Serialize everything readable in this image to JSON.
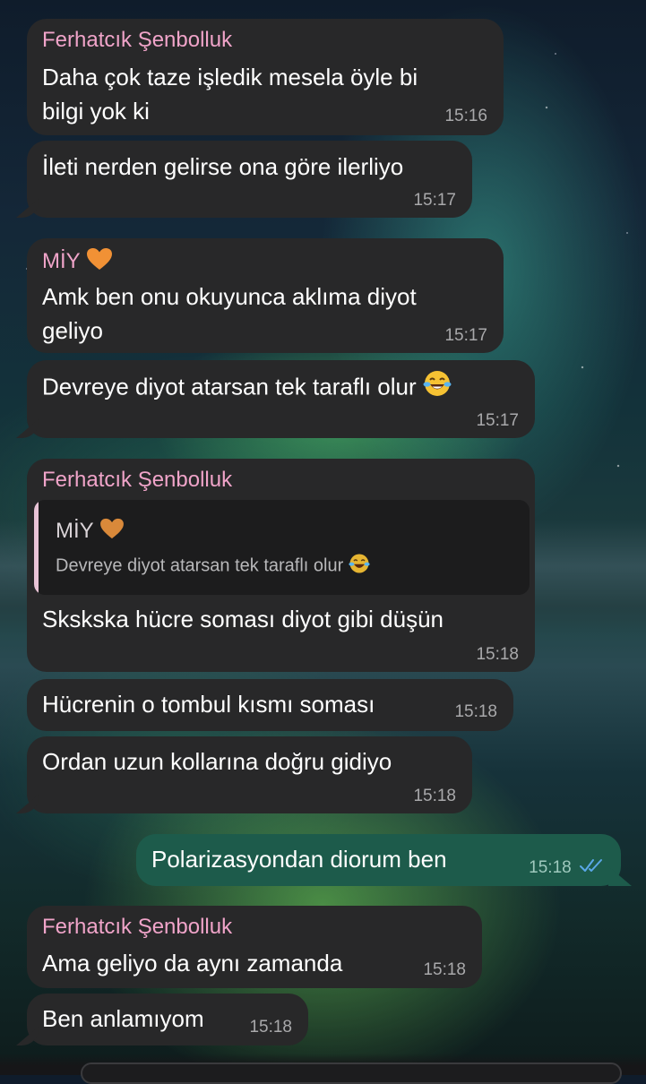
{
  "messages": [
    {
      "sender": "Ferhatcık Şenbolluk",
      "lines": [
        "Daha çok taze işledik mesela öyle bi",
        "bilgi yok ki"
      ],
      "time": "15:16"
    },
    {
      "lines": [
        "İleti nerden gelirse ona göre ilerliyo"
      ],
      "time": "15:17"
    },
    {
      "sender": "MİY",
      "lines": [
        "Amk ben onu okuyunca aklıma diyot",
        "geliyo"
      ],
      "time": "15:17"
    },
    {
      "lines": [
        "Devreye diyot atarsan tek taraflı olur"
      ],
      "time": "15:17"
    },
    {
      "sender": "Ferhatcık Şenbolluk",
      "quote": {
        "sender": "MİY",
        "text": "Devreye diyot atarsan tek taraflı olur"
      },
      "lines": [
        "Skskska hücre soması diyot gibi düşün"
      ],
      "time": "15:18"
    },
    {
      "lines": [
        "Hücrenin o tombul kısmı soması"
      ],
      "time": "15:18"
    },
    {
      "lines": [
        "Ordan uzun kollarına doğru gidiyo"
      ],
      "time": "15:18"
    },
    {
      "outgoing": true,
      "lines": [
        "Polarizasyondan diorum ben"
      ],
      "time": "15:18",
      "status": "read"
    },
    {
      "sender": "Ferhatcık Şenbolluk",
      "lines": [
        "Ama geliyo da aynı zamanda"
      ],
      "time": "15:18"
    },
    {
      "lines": [
        "Ben anlamıyom"
      ],
      "time": "15:18"
    }
  ],
  "icons": {
    "heart": "orange-heart-icon",
    "laugh": "tears-of-joy-icon",
    "read": "double-check-icon"
  },
  "colors": {
    "incoming_bubble": "#282829",
    "outgoing_bubble": "#1d5b4b",
    "sender_name": "#f0a4c9",
    "read_ticks": "#5aa7e8"
  }
}
